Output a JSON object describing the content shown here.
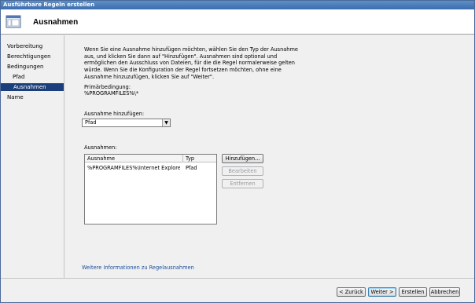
{
  "window": {
    "title": "Ausführbare Regeln erstellen"
  },
  "header": {
    "title": "Ausnahmen",
    "icon": "rules-window-icon"
  },
  "sidebar": {
    "items": [
      {
        "label": "Vorbereitung"
      },
      {
        "label": "Berechtigungen"
      },
      {
        "label": "Bedingungen"
      },
      {
        "label": "Pfad"
      },
      {
        "label": "Ausnahmen"
      },
      {
        "label": "Name"
      }
    ]
  },
  "main": {
    "description": "Wenn Sie eine Ausnahme hinzufügen möchten, wählen Sie den Typ der Ausnahme aus, und klicken Sie dann auf \"Hinzufügen\". Ausnahmen sind optional und ermöglichen den Ausschluss von Dateien, für die die Regel normalerweise gelten würde. Wenn Sie die Konfiguration der Regel fortsetzen möchten, ohne eine Ausnahme hinzuzufügen, klicken Sie auf \"Weiter\".",
    "primary_condition_label": "Primärbedingung:",
    "primary_condition_value": "%PROGRAMFILES%\\*",
    "add_exception_label": "Ausnahme hinzufügen:",
    "add_exception_selected": "Pfad",
    "exceptions_label": "Ausnahmen:",
    "table": {
      "columns": [
        "Ausnahme",
        "Typ"
      ],
      "rows": [
        {
          "exception": "%PROGRAMFILES%\\Internet Explorer\\...",
          "type": "Pfad"
        }
      ]
    },
    "buttons": {
      "add": "Hinzufügen...",
      "edit": "Bearbeiten",
      "remove": "Entfernen"
    },
    "more_info_link": "Weitere Informationen zu Regelausnahmen"
  },
  "footer": {
    "back": "< Zurück",
    "next": "Weiter >",
    "create": "Erstellen",
    "cancel": "Abbrechen"
  }
}
